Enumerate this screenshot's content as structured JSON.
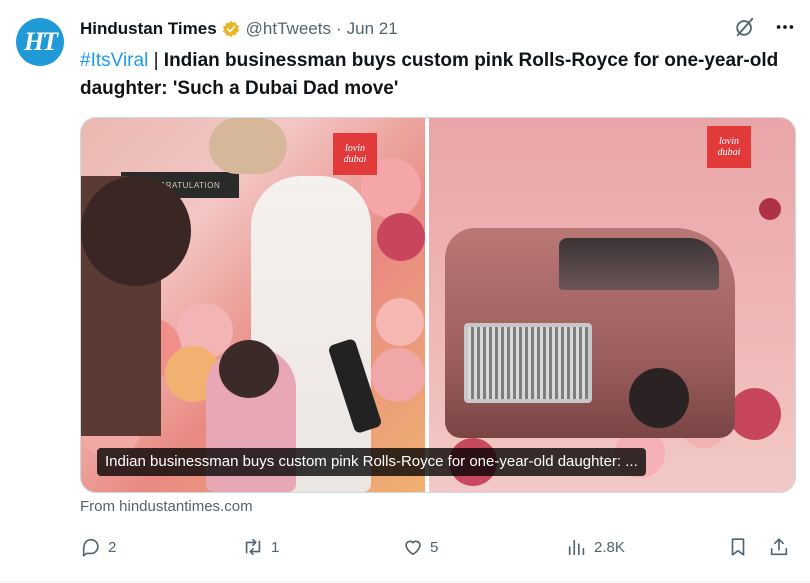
{
  "tweet": {
    "avatar_text": "HT",
    "author_name": "Hindustan Times",
    "handle": "@htTweets",
    "separator": "·",
    "date": "Jun 21",
    "hashtag": "#ItsViral",
    "pipe": "|",
    "text": "Indian businessman buys custom pink Rolls-Royce for one-year-old daughter: 'Such a Dubai Dad move'",
    "media_caption": "Indian businessman buys custom pink Rolls-Royce for one-year-old daughter: ...",
    "logo_text": "lovin dubai",
    "sign_text": "CONGRATULATION",
    "source": "From hindustantimes.com"
  },
  "actions": {
    "replies": "2",
    "retweets": "1",
    "likes": "5",
    "views": "2.8K"
  },
  "colors": {
    "accent": "#1d9bf0",
    "verified": "#e8b628",
    "muted": "#536471",
    "avatar_bg": "#1f9ad6"
  },
  "icons": [
    "grok-icon",
    "more-icon",
    "verified-badge-icon",
    "reply-icon",
    "retweet-icon",
    "like-icon",
    "views-icon",
    "bookmark-icon",
    "share-icon"
  ]
}
